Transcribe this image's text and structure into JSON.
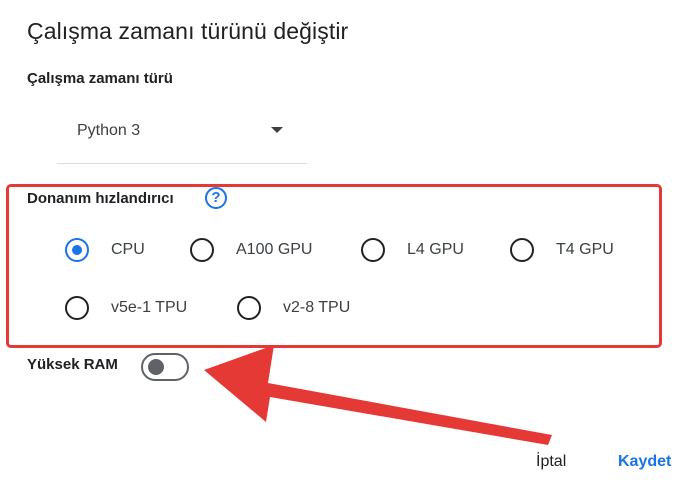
{
  "dialog": {
    "title": "Çalışma zamanı türünü değiştir"
  },
  "runtime": {
    "label": "Çalışma zamanı türü",
    "selected": "Python 3"
  },
  "hardware": {
    "label": "Donanım hızlandırıcı",
    "help_icon_glyph": "?",
    "options": [
      {
        "label": "CPU",
        "checked": true
      },
      {
        "label": "A100 GPU",
        "checked": false
      },
      {
        "label": "L4 GPU",
        "checked": false
      },
      {
        "label": "T4 GPU",
        "checked": false
      },
      {
        "label": "v5e-1 TPU",
        "checked": false
      },
      {
        "label": "v2-8 TPU",
        "checked": false
      }
    ]
  },
  "high_ram": {
    "label": "Yüksek RAM",
    "enabled": false
  },
  "actions": {
    "cancel_label": "İptal",
    "save_label": "Kaydet"
  },
  "colors": {
    "accent": "#1a73e8",
    "highlight": "#e53935",
    "annotation_arrow": "#e53935"
  },
  "icons": {
    "help": "help-circle-icon",
    "dropdown": "caret-down-icon"
  }
}
